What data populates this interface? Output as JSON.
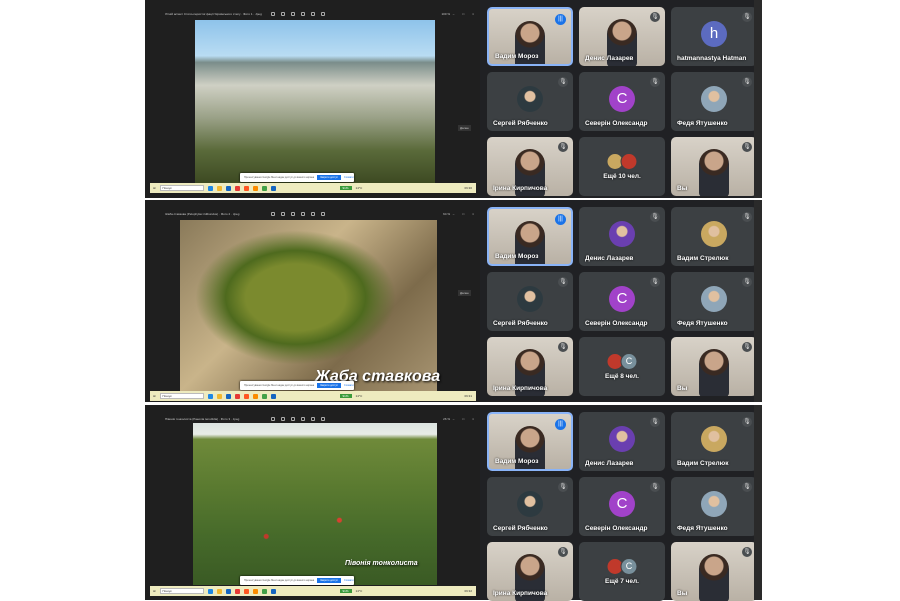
{
  "panels": [
    {
      "viewer_title": "Літній аспект Стипо-перистої фації Українського степу · Фото 1 · Jpeg",
      "zoom": "100 %",
      "side_label": "Далее",
      "caption": "",
      "notice": {
        "text": "Презентування Google Meet надає доступ до вашого екрана",
        "stop": "Закрити доступ",
        "hide": "Сховати"
      },
      "taskbar": {
        "search": "Пошук",
        "battery": "91%",
        "weather": "14°C",
        "clock": "09:30"
      },
      "tiles": [
        {
          "name": "Вадим Мороз",
          "type": "video",
          "speaking": true
        },
        {
          "name": "Денис Лазарев",
          "type": "video"
        },
        {
          "name": "hatmannastya Hatman",
          "type": "letter",
          "letter": "h",
          "color": "#5c6bc0"
        },
        {
          "name": "Сергей Рябченко",
          "type": "photo",
          "color": "#2d3a40"
        },
        {
          "name": "Северін Олександр",
          "type": "letter",
          "letter": "C",
          "color": "#a142c9"
        },
        {
          "name": "Федя Ятушенко",
          "type": "photo",
          "color": "#8fa6b8"
        },
        {
          "name": "Ірина Кирпичова",
          "type": "video"
        },
        {
          "name": "",
          "type": "more",
          "more": "Ещё 10 чел.",
          "avatars": [
            "",
            ""
          ],
          "colors": [
            "#c9a860",
            "#c0392b"
          ]
        },
        {
          "name": "Вы",
          "type": "video"
        }
      ]
    },
    {
      "viewer_title": "Жаба ставкова (Pelophylax ridibundus) · Фото 2 · Jpeg",
      "zoom": "64 %",
      "side_label": "Далее",
      "caption": "Жаба ставкова",
      "notice": {
        "text": "Презентування Google Meet надає доступ до вашого екрана",
        "stop": "Закрити доступ",
        "hide": "Сховати"
      },
      "taskbar": {
        "search": "Пошук",
        "battery": "91%",
        "weather": "14°C",
        "clock": "09:31"
      },
      "tiles": [
        {
          "name": "Вадим Мороз",
          "type": "video",
          "speaking": true
        },
        {
          "name": "Денис Лазарев",
          "type": "photo",
          "color": "#6a3fb0"
        },
        {
          "name": "Вадим Стрелюк",
          "type": "photo",
          "color": "#c9a860"
        },
        {
          "name": "Сергей Рябченко",
          "type": "photo",
          "color": "#2d3a40"
        },
        {
          "name": "Северін Олександр",
          "type": "letter",
          "letter": "C",
          "color": "#a142c9"
        },
        {
          "name": "Федя Ятушенко",
          "type": "photo",
          "color": "#8fa6b8"
        },
        {
          "name": "Ірина Кирпичова",
          "type": "video"
        },
        {
          "name": "",
          "type": "more",
          "more": "Ещё 8 чел.",
          "avatars": [
            "",
            "C"
          ],
          "colors": [
            "#c0392b",
            "#78909c"
          ]
        },
        {
          "name": "Вы",
          "type": "video"
        }
      ]
    },
    {
      "viewer_title": "Півонія тонколиста (Paeonia tenuifolia) · Фото 3 · Jpeg",
      "zoom": "26 %",
      "side_label": "",
      "caption": "Півонія тонколиста",
      "notice": {
        "text": "Презентування Google Meet надає доступ до вашого екрана",
        "stop": "Закрити доступ",
        "hide": "Сховати"
      },
      "taskbar": {
        "search": "Пошук",
        "battery": "91%",
        "weather": "14°C",
        "clock": "09:32"
      },
      "tiles": [
        {
          "name": "Вадим Мороз",
          "type": "video",
          "speaking": true
        },
        {
          "name": "Денис Лазарев",
          "type": "photo",
          "color": "#6a3fb0"
        },
        {
          "name": "Вадим Стрелюк",
          "type": "photo",
          "color": "#c9a860"
        },
        {
          "name": "Сергей Рябченко",
          "type": "photo",
          "color": "#2d3a40"
        },
        {
          "name": "Северін Олександр",
          "type": "letter",
          "letter": "C",
          "color": "#a142c9"
        },
        {
          "name": "Федя Ятушенко",
          "type": "photo",
          "color": "#8fa6b8"
        },
        {
          "name": "Ірина Кирпичова",
          "type": "video"
        },
        {
          "name": "",
          "type": "more",
          "more": "Ещё 7 чел.",
          "avatars": [
            "",
            "C"
          ],
          "colors": [
            "#c0392b",
            "#78909c"
          ]
        },
        {
          "name": "Вы",
          "type": "video"
        }
      ]
    }
  ]
}
